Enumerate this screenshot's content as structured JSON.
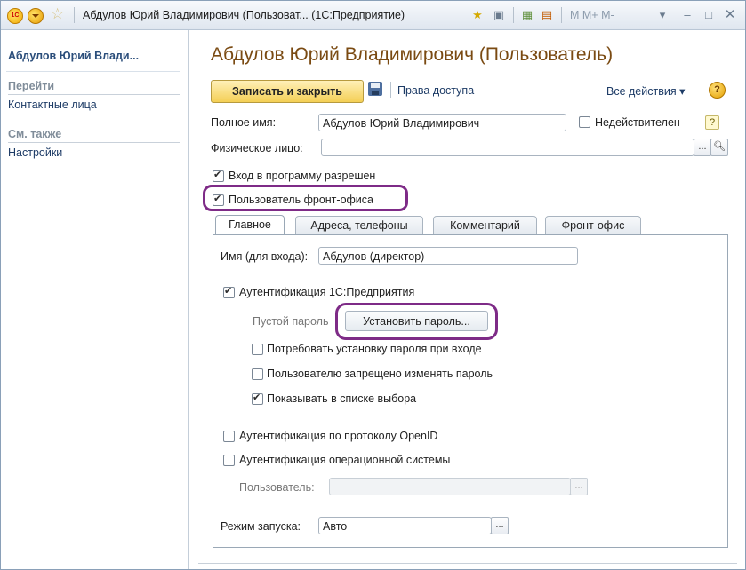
{
  "titlebar": {
    "title": "Абдулов Юрий Владимирович (Пользоват...  (1С:Предприятие)",
    "extra_text": "M  M+ M-"
  },
  "leftpanel": {
    "title": "Абдулов Юрий Влади...",
    "sections": [
      {
        "header": "Перейти",
        "links": [
          "Контактные лица"
        ]
      },
      {
        "header": "См. также",
        "links": [
          "Настройки"
        ]
      }
    ]
  },
  "form": {
    "title": "Абдулов Юрий Владимирович (Пользователь)",
    "toolbar": {
      "save_close_label": "Записать и закрыть",
      "access_rights_label": "Права доступа",
      "all_actions_label": "Все действия ▾"
    },
    "full_name_label": "Полное имя:",
    "full_name_value": "Абдулов Юрий Владимирович",
    "invalid_label": "Недействителен",
    "person_label": "Физическое лицо:",
    "person_value": "",
    "login_allowed_label": "Вход в программу разрешен",
    "front_office_label": "Пользователь фронт-офиса",
    "tabs": [
      "Главное",
      "Адреса, телефоны",
      "Комментарий",
      "Фронт-офис"
    ],
    "main_tab": {
      "login_name_label": "Имя (для входа):",
      "login_name_value": "Абдулов (директор)",
      "auth_1c_label": "Аутентификация 1С:Предприятия",
      "empty_password_label": "Пустой пароль",
      "set_password_label": "Установить пароль...",
      "require_set_password_label": "Потребовать установку пароля при входе",
      "forbid_change_password_label": "Пользователю запрещено изменять пароль",
      "show_in_list_label": "Показывать в списке выбора",
      "openid_label": "Аутентификация по протоколу OpenID",
      "os_auth_label": "Аутентификация операционной системы",
      "os_user_label": "Пользователь:",
      "os_user_value": "",
      "launch_mode_label": "Режим запуска:",
      "launch_mode_value": "Авто"
    }
  },
  "checkbox_states": {
    "invalid": false,
    "login_allowed": true,
    "front_office": true,
    "auth_1c": true,
    "require_set_password": false,
    "forbid_change_password": false,
    "show_in_list": true,
    "openid": false,
    "os_auth": false
  },
  "colors": {
    "title_text": "#7a4a12",
    "highlight": "#7e2b87",
    "primary_button": "#f4cf55",
    "link": "#1d3b66"
  }
}
